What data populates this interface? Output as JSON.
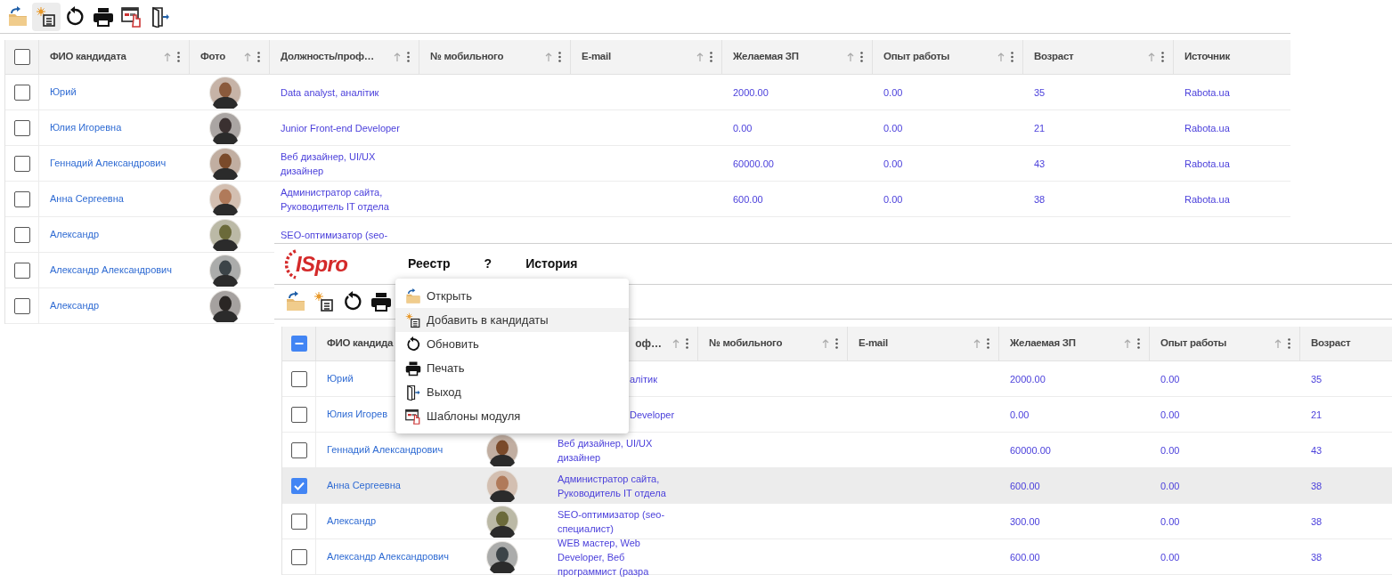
{
  "panel_a": {
    "toolbar": [
      {
        "kind": "open",
        "hovered": false
      },
      {
        "kind": "add",
        "hovered": true
      },
      {
        "kind": "refresh",
        "hovered": false
      },
      {
        "kind": "print",
        "hovered": false
      },
      {
        "kind": "templates",
        "hovered": false
      },
      {
        "kind": "exit",
        "hovered": false
      }
    ],
    "table": {
      "header_checkbox": {
        "checked": false
      },
      "columns": [
        {
          "kind": "full",
          "label": "ФИО кандидата",
          "sortable": true
        },
        {
          "kind": "full",
          "label": "Фото",
          "sortable": true
        },
        {
          "kind": "full",
          "label": "Должность/проф…",
          "sortable": true
        },
        {
          "kind": "full",
          "label": "№ мобильного",
          "sortable": true
        },
        {
          "kind": "full",
          "label": "E-mail",
          "sortable": true
        },
        {
          "kind": "full",
          "label": "Желаемая ЗП",
          "sortable": true
        },
        {
          "kind": "full",
          "label": "Опыт работы",
          "sortable": true
        },
        {
          "kind": "full",
          "label": "Возраст",
          "sortable": true
        },
        {
          "kind": "full",
          "label": "Источник",
          "sortable": false
        }
      ],
      "rows": [
        {
          "checked": false,
          "name": "Юрий",
          "job": "Data analyst, аналітик",
          "salary": "2000.00",
          "experience": "0.00",
          "age": "35",
          "source": "Rabota.ua"
        },
        {
          "checked": false,
          "name": "Юлия Игоревна",
          "job": "Junior Front-end Developer",
          "salary": "0.00",
          "experience": "0.00",
          "age": "21",
          "source": "Rabota.ua"
        },
        {
          "checked": false,
          "name": "Геннадий Александрович",
          "job": "Веб дизайнер, UI/UX дизайнер",
          "salary": "60000.00",
          "experience": "0.00",
          "age": "43",
          "source": "Rabota.ua"
        },
        {
          "checked": false,
          "name": "Анна Сергеевна",
          "job": "Администратор сайта, Руководитель IT отдела",
          "salary": "600.00",
          "experience": "0.00",
          "age": "38",
          "source": "Rabota.ua"
        },
        {
          "checked": false,
          "name": "Александр",
          "job": "SEO-оптимизатор (seo-"
        },
        {
          "checked": false,
          "name": "Александр Александрович"
        },
        {
          "checked": false,
          "name": "Александр"
        }
      ]
    }
  },
  "panel_b": {
    "logo": "ISpro",
    "menu_bar": [
      "Реестр",
      "?",
      "История"
    ],
    "toolbar": [
      {
        "kind": "open",
        "hovered": false
      },
      {
        "kind": "add",
        "hovered": false
      },
      {
        "kind": "refresh",
        "hovered": false
      },
      {
        "kind": "print",
        "hovered": false
      }
    ],
    "table": {
      "header_checkbox": {
        "indeterminate": true
      },
      "columns": [
        {
          "kind": "full",
          "label": "ФИО кандида"
        },
        {
          "kind": "covered"
        },
        {
          "kind": "tail",
          "label": "оф…",
          "sortable": true
        },
        {
          "kind": "full",
          "label": "№ мобильного",
          "sortable": true
        },
        {
          "kind": "full",
          "label": "E-mail",
          "sortable": true
        },
        {
          "kind": "full",
          "label": "Желаемая ЗП",
          "sortable": true
        },
        {
          "kind": "full",
          "label": "Опыт работы",
          "sortable": true
        },
        {
          "kind": "full",
          "label": "Возраст"
        }
      ],
      "rows": [
        {
          "checked": false,
          "selected": false,
          "name": "Юрий",
          "job_tail": "алітик",
          "salary": "2000.00",
          "experience": "0.00",
          "age": "35"
        },
        {
          "checked": false,
          "selected": false,
          "name": "Юлия Игорев",
          "job_tail": "Developer",
          "salary": "0.00",
          "experience": "0.00",
          "age": "21"
        },
        {
          "checked": false,
          "selected": false,
          "name": "Геннадий Александрович",
          "job": "Веб дизайнер, UI/UX дизайнер",
          "salary": "60000.00",
          "experience": "0.00",
          "age": "43"
        },
        {
          "checked": true,
          "selected": true,
          "name": "Анна Сергеевна",
          "job": "Администратор сайта, Руководитель IT отдела",
          "salary": "600.00",
          "experience": "0.00",
          "age": "38"
        },
        {
          "checked": false,
          "selected": false,
          "name": "Александр",
          "job": "SEO-оптимизатор (seo-специалист)",
          "salary": "300.00",
          "experience": "0.00",
          "age": "38"
        },
        {
          "checked": false,
          "selected": false,
          "name": "Александр Александрович",
          "job": "WEB мастер, Web Developer, Веб программист (разра",
          "salary": "600.00",
          "experience": "0.00",
          "age": "38"
        }
      ]
    },
    "menu": {
      "items": [
        {
          "kind": "open",
          "label": "Открыть",
          "highlighted": false
        },
        {
          "kind": "add",
          "label": "Добавить в кандидаты",
          "highlighted": true
        },
        {
          "kind": "refresh",
          "label": "Обновить",
          "highlighted": false
        },
        {
          "kind": "print",
          "label": "Печать",
          "highlighted": false
        },
        {
          "kind": "exit",
          "label": "Выход",
          "highlighted": false
        },
        {
          "kind": "templates",
          "label": "Шаблоны модуля",
          "highlighted": false
        }
      ]
    }
  }
}
